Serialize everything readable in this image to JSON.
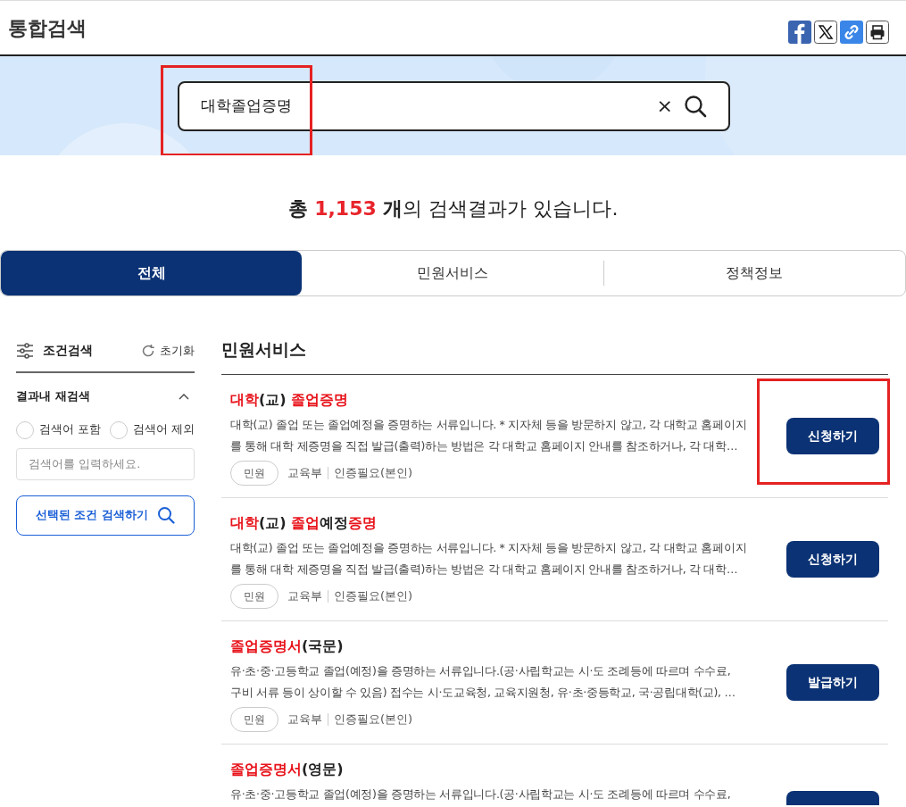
{
  "page_title": "통합검색",
  "share_buttons": [
    {
      "kind": "facebook"
    },
    {
      "kind": "x"
    },
    {
      "kind": "link"
    },
    {
      "kind": "print"
    }
  ],
  "search": {
    "value": "대학졸업증명",
    "clear": "×",
    "highlighted": true
  },
  "summary": {
    "before": "총 ",
    "count": "1,153",
    "unit": " 개",
    "after": "의 검색결과가 있습니다."
  },
  "tabs": [
    {
      "label": "전체",
      "selected": true
    },
    {
      "label": "민원서비스",
      "selected": false
    },
    {
      "label": "정책정보",
      "selected": false
    }
  ],
  "sidebar": {
    "title": "조건검색",
    "reset": "초기화",
    "section": "결과내 재검색",
    "expanded": true,
    "options": [
      {
        "label": "검색어 포함",
        "selected": false
      },
      {
        "label": "검색어 제외",
        "selected": false
      }
    ],
    "placeholder": "검색어를 입력하세요.",
    "submit": "선택된 조건 검색하기"
  },
  "section_title": "민원서비스",
  "results": [
    {
      "title": [
        {
          "text": "대학",
          "match": true
        },
        {
          "text": "(교) ",
          "match": false
        },
        {
          "text": "졸업증명",
          "match": true
        }
      ],
      "lines": [
        "대학(교) 졸업 또는 졸업예정을 증명하는 서류입니다. * 지자체 등을 방문하지 않고, 각 대학교 홈페이지",
        "를 통해 대학 제증명을 직접 발급(출력)하는 방법은 각 대학교 홈페이지 안내를 참조하거나, 각 대학…"
      ],
      "tag": "민원",
      "ministry": "교육부",
      "auth": "인증필요(본인)",
      "button": "신청하기",
      "highlighted": true
    },
    {
      "title": [
        {
          "text": "대학",
          "match": true
        },
        {
          "text": "(교) ",
          "match": false
        },
        {
          "text": "졸업",
          "match": true
        },
        {
          "text": "예정",
          "match": false
        },
        {
          "text": "증명",
          "match": true
        }
      ],
      "lines": [
        "대학(교) 졸업 또는 졸업예정을 증명하는 서류입니다. * 지자체 등을 방문하지 않고, 각 대학교 홈페이지",
        "를 통해 대학 제증명을 직접 발급(출력)하는 방법은 각 대학교 홈페이지 안내를 참조하거나, 각 대학…"
      ],
      "tag": "민원",
      "ministry": "교육부",
      "auth": "인증필요(본인)",
      "button": "신청하기",
      "highlighted": false
    },
    {
      "title": [
        {
          "text": "졸업증명서",
          "match": true
        },
        {
          "text": "(국문)",
          "match": false
        }
      ],
      "lines": [
        "유·초·중·고등학교 졸업(예정)을 증명하는 서류입니다.(공·사립학교는 시·도 조례등에 따르며 수수료,",
        "구비 서류 등이 상이할 수 있음) 접수는 시·도교육청, 교육지원청, 유·초·중등학교, 국·공립대학(교), …"
      ],
      "tag": "민원",
      "ministry": "교육부",
      "auth": "인증필요(본인)",
      "button": "발급하기",
      "highlighted": false
    },
    {
      "title": [
        {
          "text": "졸업증명서",
          "match": true
        },
        {
          "text": "(영문)",
          "match": false
        }
      ],
      "lines": [
        "유·초·중·고등학교 졸업(예정)을 증명하는 서류입니다.(공·사립학교는 시·도 조례등에 따르며 수수료,"
      ],
      "highlighted": false
    }
  ]
}
